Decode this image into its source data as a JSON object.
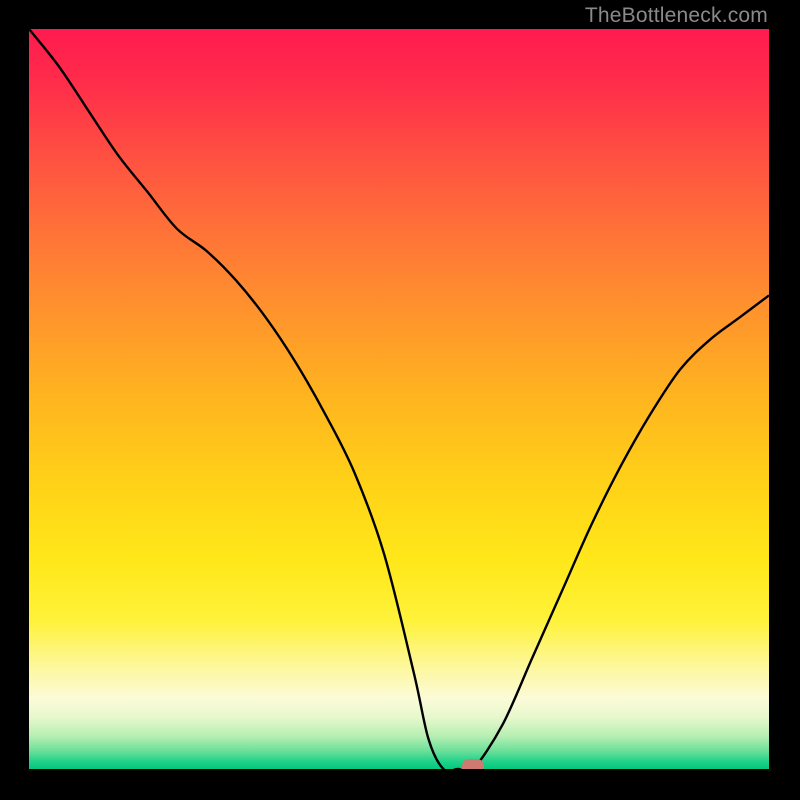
{
  "watermark": "TheBottleneck.com",
  "chart_data": {
    "type": "line",
    "title": "",
    "xlabel": "",
    "ylabel": "",
    "xlim": [
      0,
      100
    ],
    "ylim": [
      0,
      100
    ],
    "background": {
      "type": "vertical-gradient",
      "stops": [
        {
          "pos": 0,
          "color": "#ff1a4f"
        },
        {
          "pos": 0.08,
          "color": "#ff2f4a"
        },
        {
          "pos": 0.2,
          "color": "#ff5a3f"
        },
        {
          "pos": 0.35,
          "color": "#ff8a30"
        },
        {
          "pos": 0.5,
          "color": "#ffb51f"
        },
        {
          "pos": 0.62,
          "color": "#ffd317"
        },
        {
          "pos": 0.72,
          "color": "#ffe81a"
        },
        {
          "pos": 0.8,
          "color": "#fff23b"
        },
        {
          "pos": 0.86,
          "color": "#fdf79a"
        },
        {
          "pos": 0.905,
          "color": "#fbfbd8"
        },
        {
          "pos": 0.93,
          "color": "#e7f8cd"
        },
        {
          "pos": 0.955,
          "color": "#b8efb3"
        },
        {
          "pos": 0.975,
          "color": "#6ee09a"
        },
        {
          "pos": 0.99,
          "color": "#1fd289"
        },
        {
          "pos": 1.0,
          "color": "#05c77f"
        }
      ]
    },
    "series": [
      {
        "name": "bottleneck-curve",
        "color": "#000000",
        "x": [
          0,
          4,
          8,
          12,
          16,
          20,
          24,
          28,
          32,
          36,
          40,
          44,
          48,
          52,
          54,
          56,
          58,
          60,
          64,
          68,
          72,
          76,
          80,
          84,
          88,
          92,
          96,
          100
        ],
        "y": [
          100,
          95,
          89,
          83,
          78,
          73,
          70,
          66,
          61,
          55,
          48,
          40,
          29,
          13,
          4,
          0,
          0,
          0,
          6,
          15,
          24,
          33,
          41,
          48,
          54,
          58,
          61,
          64
        ]
      }
    ],
    "marker": {
      "name": "optimal-point",
      "x": 60,
      "y": 0,
      "color": "#cf7a70",
      "shape": "rounded-rect"
    },
    "grid": false,
    "legend": false
  }
}
